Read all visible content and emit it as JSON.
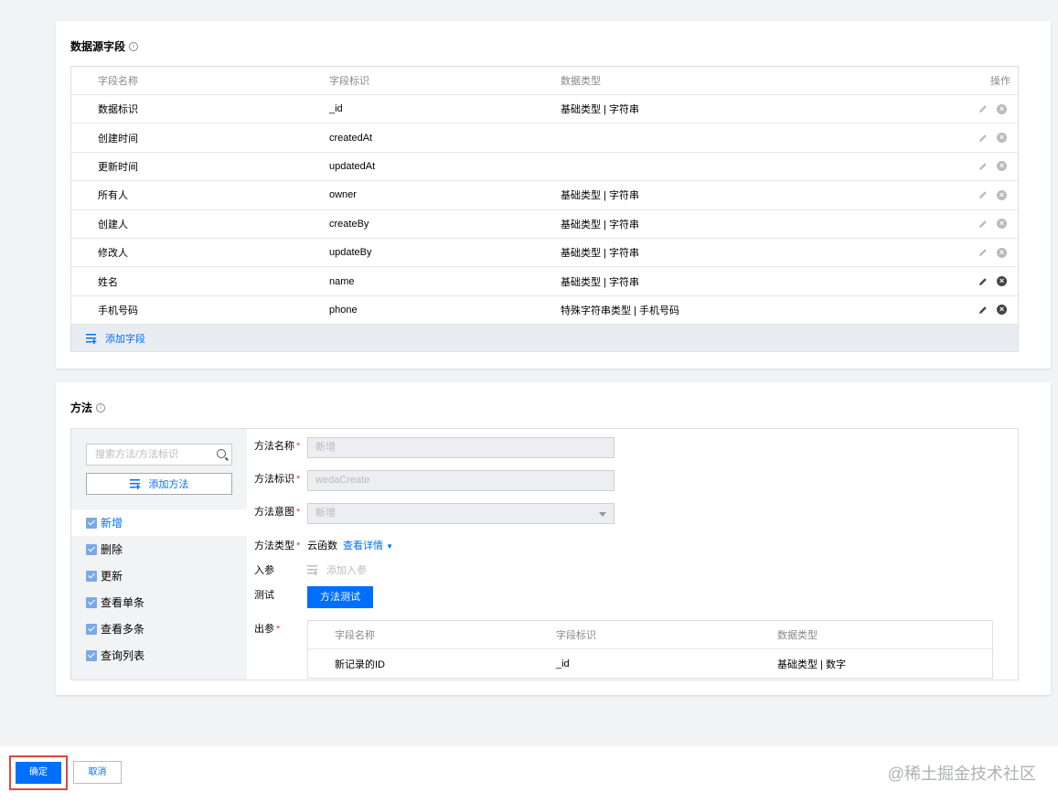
{
  "fields_card": {
    "title": "数据源字段",
    "columns": [
      "字段名称",
      "字段标识",
      "数据类型",
      "操作"
    ],
    "rows": [
      {
        "name": "数据标识",
        "id": "_id",
        "type": "基础类型 | 字符串",
        "editable": false
      },
      {
        "name": "创建时间",
        "id": "createdAt",
        "type": "",
        "editable": false
      },
      {
        "name": "更新时间",
        "id": "updatedAt",
        "type": "",
        "editable": false
      },
      {
        "name": "所有人",
        "id": "owner",
        "type": "基础类型 | 字符串",
        "editable": false
      },
      {
        "name": "创建人",
        "id": "createBy",
        "type": "基础类型 | 字符串",
        "editable": false
      },
      {
        "name": "修改人",
        "id": "updateBy",
        "type": "基础类型 | 字符串",
        "editable": false
      },
      {
        "name": "姓名",
        "id": "name",
        "type": "基础类型 | 字符串",
        "editable": true
      },
      {
        "name": "手机号码",
        "id": "phone",
        "type": "特殊字符串类型 | 手机号码",
        "editable": true
      }
    ],
    "add_field_label": "添加字段"
  },
  "methods_card": {
    "title": "方法",
    "search_placeholder": "搜索方法/方法标识",
    "add_method_label": "添加方法",
    "methods": [
      "新增",
      "删除",
      "更新",
      "查看单条",
      "查看多条",
      "查询列表"
    ],
    "active_method": "新增",
    "form": {
      "name_label": "方法名称",
      "name_value": "新增",
      "id_label": "方法标识",
      "id_value": "wedaCreate",
      "intent_label": "方法意图",
      "intent_value": "新增",
      "type_label": "方法类型",
      "type_value": "云函数",
      "detail_link": "查看详情",
      "params_label": "入参",
      "add_param_label": "添加入参",
      "test_label": "测试",
      "test_button": "方法测试",
      "output_label": "出参",
      "output_columns": [
        "字段名称",
        "字段标识",
        "数据类型"
      ],
      "output_rows": [
        {
          "name": "新记录的ID",
          "id": "_id",
          "type": "基础类型 | 数字"
        }
      ]
    }
  },
  "footer": {
    "ok_label": "确定",
    "cancel_label": "取消",
    "watermark": "@稀土掘金技术社区"
  },
  "colors": {
    "primary": "#006eff",
    "required": "#e54545",
    "highlight_border": "#e0463a"
  }
}
